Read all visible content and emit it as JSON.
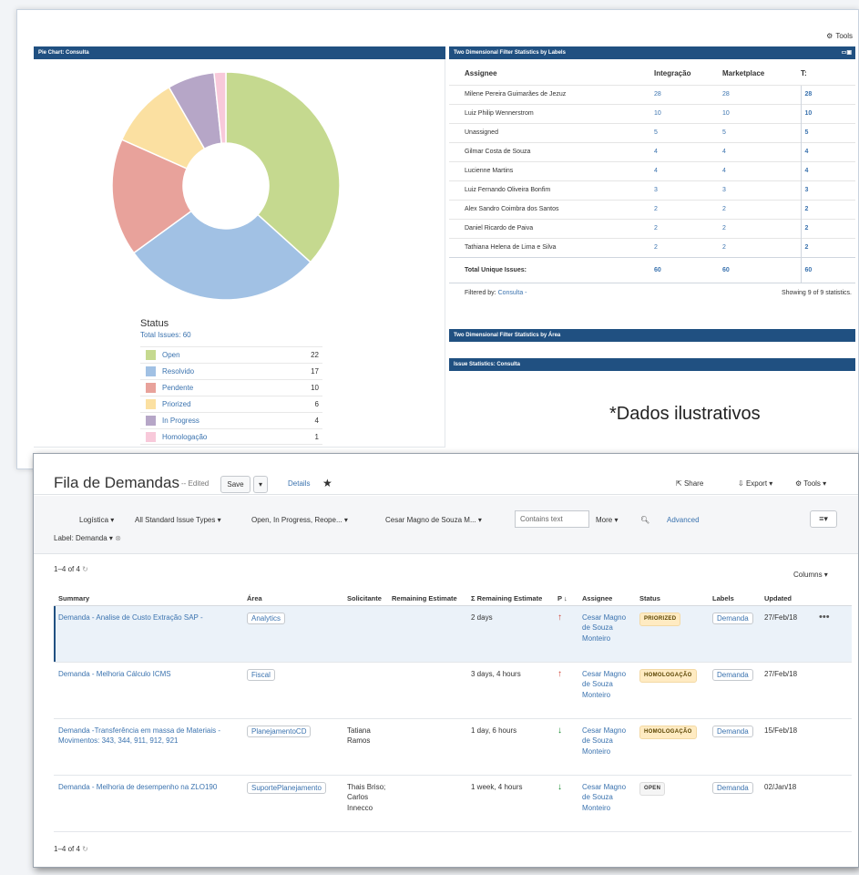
{
  "dashboard": {
    "tools_label": "Tools",
    "pie_gadget": {
      "title": "Pie Chart: Consulta",
      "legend_title": "Status",
      "total_label": "Total Issues: 60"
    },
    "stats_gadget": {
      "title": "Two Dimensional Filter Statistics by Labels",
      "columns": [
        "Assignee",
        "Integração",
        "Marketplace",
        "T:"
      ],
      "rows": [
        {
          "name": "Milene Pereira Guimarães de Jezuz",
          "a": "28",
          "b": "28",
          "t": "28"
        },
        {
          "name": "Luiz Philip Wennerstrom",
          "a": "10",
          "b": "10",
          "t": "10"
        },
        {
          "name": "Unassigned",
          "a": "5",
          "b": "5",
          "t": "5"
        },
        {
          "name": "Gilmar Costa de Souza",
          "a": "4",
          "b": "4",
          "t": "4"
        },
        {
          "name": "Lucienne Martins",
          "a": "4",
          "b": "4",
          "t": "4"
        },
        {
          "name": "Luiz Fernando Oliveira Bonfim",
          "a": "3",
          "b": "3",
          "t": "3"
        },
        {
          "name": "Alex Sandro Coimbra dos Santos",
          "a": "2",
          "b": "2",
          "t": "2"
        },
        {
          "name": "Daniel Ricardo de Paiva",
          "a": "2",
          "b": "2",
          "t": "2"
        },
        {
          "name": "Tathiana Helena de Lima e Silva",
          "a": "2",
          "b": "2",
          "t": "2"
        }
      ],
      "total": {
        "name": "Total Unique Issues:",
        "a": "60",
        "b": "60",
        "t": "60"
      },
      "filtered_by_label": "Filtered by:",
      "filtered_by_value": "Consulta -",
      "showing": "Showing 9 of 9 statistics."
    },
    "dim_area_title": "Two Dimensional Filter Statistics by Área",
    "issue_stats_title": "Issue Statistics: Consulta",
    "watermark": "*Dados ilustrativos"
  },
  "chart_data": {
    "type": "pie",
    "title": "Pie Chart: Consulta",
    "legend_title": "Status",
    "total": 60,
    "slices": [
      {
        "label": "Open",
        "value": 22,
        "color": "#c5d98f"
      },
      {
        "label": "Resolvido",
        "value": 17,
        "color": "#a1c1e4"
      },
      {
        "label": "Pendente",
        "value": 10,
        "color": "#e8a29b"
      },
      {
        "label": "Priorized",
        "value": 6,
        "color": "#fbe0a1"
      },
      {
        "label": "In Progress",
        "value": 4,
        "color": "#b6a6c7"
      },
      {
        "label": "Homologação",
        "value": 1,
        "color": "#f8c9da"
      }
    ]
  },
  "filter": {
    "title": "Fila de Demandas",
    "edited": "-- Edited",
    "save_label": "Save",
    "save_drop": "▾",
    "details_label": "Details",
    "share_label": "Share",
    "export_label": "Export ▾",
    "tools_label": "Tools ▾",
    "criteria": {
      "project": "Logística ▾",
      "type": "All Standard Issue Types ▾",
      "status": "Open, In Progress, Reope... ▾",
      "assignee": "Cesar Magno de Souza M... ▾",
      "contains_placeholder": "Contains text",
      "more": "More ▾",
      "advanced": "Advanced",
      "label_filter": "Label: Demanda ▾"
    },
    "count": "1–4 of 4",
    "columns_label": "Columns ▾",
    "headers": [
      "Summary",
      "Área",
      "Solicitante",
      "Remaining Estimate",
      "Σ Remaining Estimate",
      "P",
      "Assignee",
      "Status",
      "Labels",
      "Updated"
    ],
    "issues": [
      {
        "summary": "Demanda - Analise de Custo Extração SAP -",
        "area": "Analytics",
        "solicitante": "",
        "remaining": "",
        "sum_remaining": "2 days",
        "priority": "↑",
        "assignee": "Cesar Magno de Souza Monteiro",
        "status": "PRIORIZED",
        "label": "Demanda",
        "updated": "27/Feb/18"
      },
      {
        "summary": "Demanda - Melhoria Cálculo ICMS",
        "area": "Fiscal",
        "solicitante": "",
        "remaining": "",
        "sum_remaining": "3 days, 4 hours",
        "priority": "↑",
        "assignee": "Cesar Magno de Souza Monteiro",
        "status": "HOMOLOGAÇÃO",
        "label": "Demanda",
        "updated": "27/Feb/18"
      },
      {
        "summary": "Demanda -Transferência em massa de Materiais - Movimentos: 343, 344, 911, 912, 921",
        "area": "PlanejamentoCD",
        "solicitante": "Tatiana Ramos",
        "remaining": "",
        "sum_remaining": "1 day, 6 hours",
        "priority": "↓",
        "assignee": "Cesar Magno de Souza Monteiro",
        "status": "HOMOLOGAÇÃO",
        "label": "Demanda",
        "updated": "15/Feb/18"
      },
      {
        "summary": "Demanda - Melhoria de desempenho na ZLO190",
        "area": "SuportePlanejamento",
        "solicitante": "Thais Briso; Carlos Innecco",
        "remaining": "",
        "sum_remaining": "1 week, 4 hours",
        "priority": "↓",
        "assignee": "Cesar Magno de Souza Monteiro",
        "status": "OPEN",
        "label": "Demanda",
        "updated": "02/Jan/18"
      }
    ],
    "row_actions": "•••",
    "count_bottom": "1–4 of 4"
  }
}
